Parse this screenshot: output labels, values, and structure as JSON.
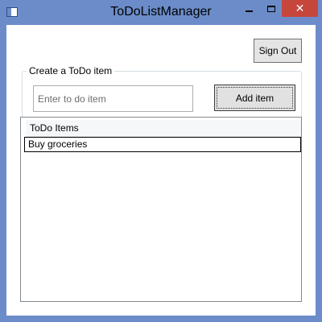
{
  "window": {
    "title": "ToDoListManager",
    "close_glyph": "✕"
  },
  "toolbar": {
    "sign_out_label": "Sign Out"
  },
  "create_group": {
    "legend": "Create a ToDo item",
    "input_value": "",
    "input_placeholder": "Enter to do item",
    "add_label": "Add item"
  },
  "list": {
    "columns": [
      "ToDo Items"
    ],
    "rows": [
      {
        "label": "Buy groceries"
      }
    ]
  },
  "colors": {
    "frame": "#6b8cc9",
    "close_button": "#c7463c"
  }
}
